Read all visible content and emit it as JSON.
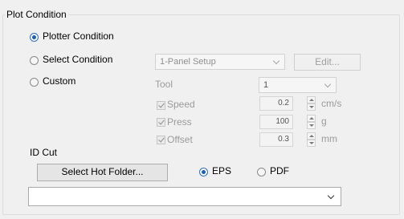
{
  "group": {
    "title": "Plot Condition"
  },
  "options": {
    "plotter": "Plotter Condition",
    "select": "Select Condition",
    "custom": "Custom"
  },
  "select_condition": {
    "value": "1-Panel Setup",
    "edit_label": "Edit..."
  },
  "tool": {
    "label": "Tool",
    "value": "1"
  },
  "params": [
    {
      "label": "Speed",
      "value": "0.2",
      "unit": "cm/s",
      "checked": true
    },
    {
      "label": "Press",
      "value": "100",
      "unit": "g",
      "checked": true
    },
    {
      "label": "Offset",
      "value": "0.3",
      "unit": "mm",
      "checked": true
    }
  ],
  "id_cut": {
    "title": "ID Cut",
    "hot_folder_label": "Select Hot Folder...",
    "format_eps": "EPS",
    "format_pdf": "PDF",
    "selected_format": "EPS",
    "folder_value": ""
  }
}
